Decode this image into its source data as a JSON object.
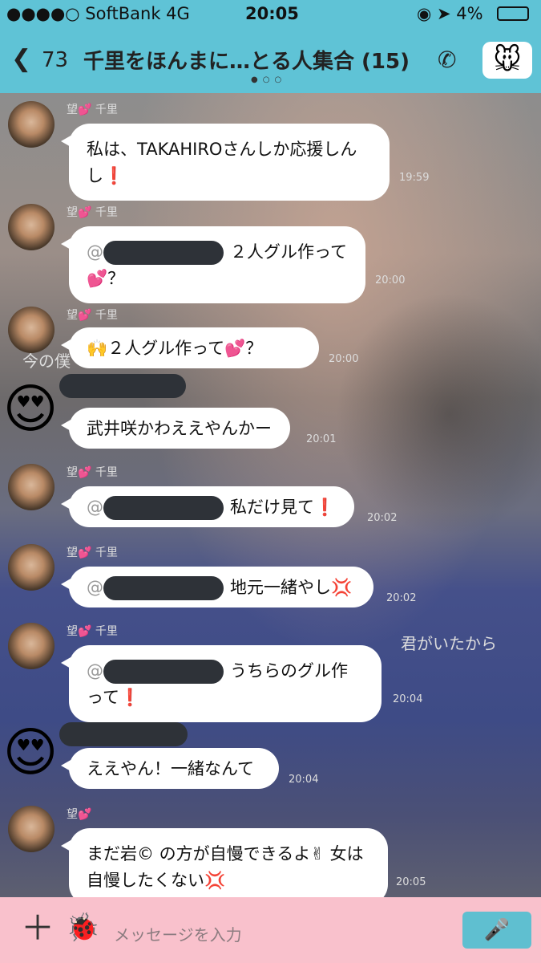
{
  "status": {
    "carrier": "●●●●○ SoftBank  4G",
    "time": "20:05",
    "right": "◉ ➤  4%"
  },
  "header": {
    "back_count": "73",
    "title": "千里をほんまに…とる人集合 (15)"
  },
  "messages": [
    {
      "name": "望💕 千里",
      "text": "私は、TAKAHIROさんしか応援しんし❗",
      "time": "19:59"
    },
    {
      "name": "望💕 千里",
      "text": "２人グル作って💕？",
      "time": "20:00"
    },
    {
      "name": "望💕 千里",
      "text": "🙌２人グル作って💕？",
      "time": "20:00"
    },
    {
      "name": "",
      "text": "武井咲かわええやんかー",
      "time": "20:01"
    },
    {
      "name": "望💕 千里",
      "text": "私だけ見て❗",
      "time": "20:02"
    },
    {
      "name": "望💕 千里",
      "text": "地元一緒やし💢",
      "time": "20:02"
    },
    {
      "name": "望💕 千里",
      "text": "うちらのグル作って❗",
      "time": "20:04"
    },
    {
      "name": "",
      "text": "ええやん！一緒なんて",
      "time": "20:04"
    },
    {
      "name": "望💕",
      "text": "まだ岩© の方が自慢できるよ✌ 女は自慢したくない💢",
      "time": "20:05"
    }
  ],
  "overlay_texts": {
    "left": "今の僕",
    "right": "君がいたから"
  },
  "input": {
    "placeholder": "メッセージを入力"
  },
  "icons": {
    "back": "chevron-left-icon",
    "phone": "phone-icon",
    "plus": "plus-icon",
    "sticker": "sticker-icon",
    "mic": "microphone-icon"
  }
}
